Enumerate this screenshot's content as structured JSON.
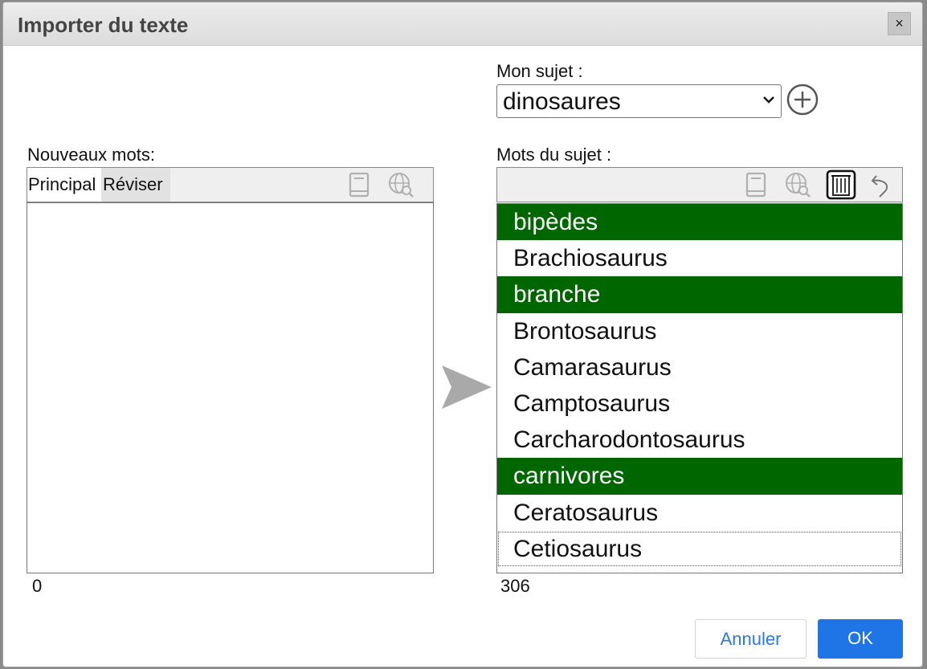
{
  "dialog": {
    "title": "Importer du texte",
    "close_label": "×"
  },
  "subject": {
    "label": "Mon sujet :",
    "selected": "dinosaures"
  },
  "new_words": {
    "label": "Nouveaux mots:",
    "tabs": [
      "Principal",
      "Réviser"
    ],
    "active_tab": "Principal",
    "items": [],
    "count": "0"
  },
  "subject_words": {
    "label": "Mots du sujet :",
    "items": [
      {
        "text": "bipèdes",
        "selected": true
      },
      {
        "text": "Brachiosaurus",
        "selected": false
      },
      {
        "text": "branche",
        "selected": true
      },
      {
        "text": "Brontosaurus",
        "selected": false
      },
      {
        "text": "Camarasaurus",
        "selected": false
      },
      {
        "text": "Camptosaurus",
        "selected": false
      },
      {
        "text": "Carcharodontosaurus",
        "selected": false
      },
      {
        "text": "carnivores",
        "selected": true
      },
      {
        "text": "Ceratosaurus",
        "selected": false
      },
      {
        "text": "Cetiosaurus",
        "selected": false,
        "focused": true
      }
    ],
    "count": "306"
  },
  "icons": {
    "left_toolbar": [
      "book-icon",
      "web-search-icon"
    ],
    "right_toolbar": [
      "book-icon",
      "web-search-icon",
      "trash-icon",
      "undo-icon"
    ],
    "add": "plus-circle-icon",
    "transfer": "send-arrow-icon"
  },
  "colors": {
    "selected_row": "#006600",
    "ok_button": "#1f74e6",
    "cancel_text": "#2a7ae2",
    "title_text": "#444444"
  },
  "buttons": {
    "cancel": "Annuler",
    "ok": "OK"
  }
}
